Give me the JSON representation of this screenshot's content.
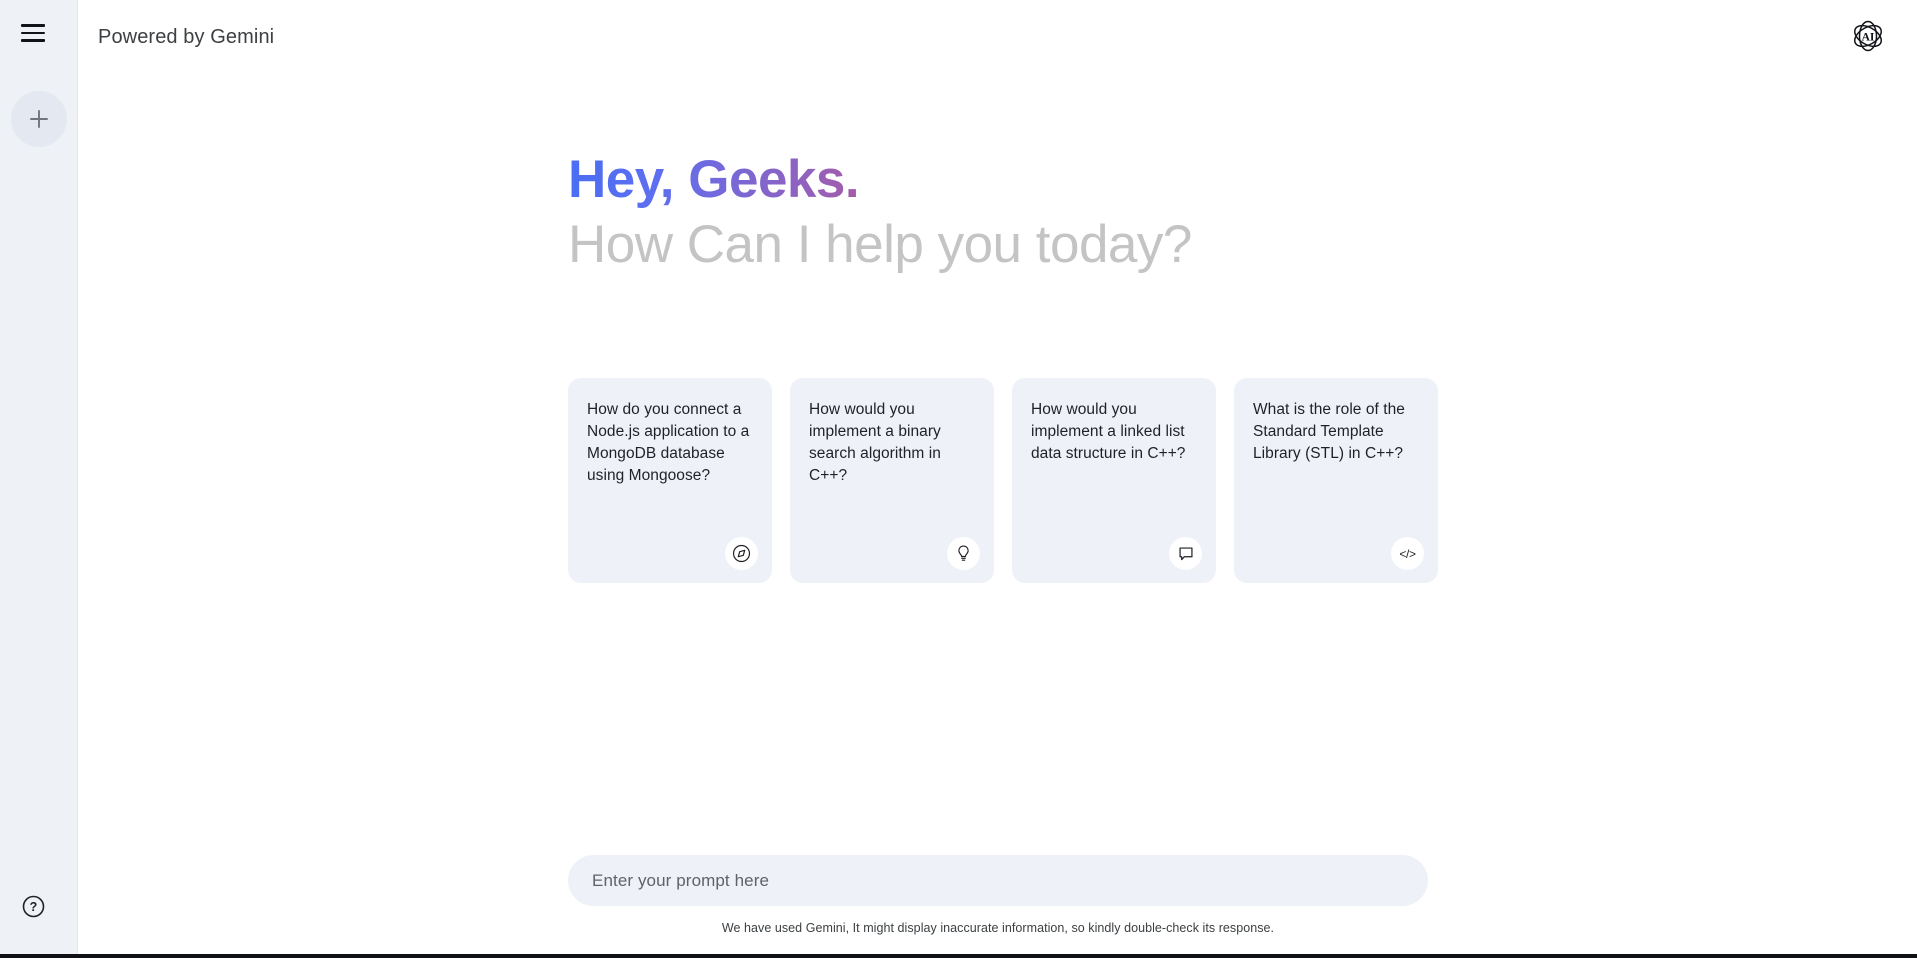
{
  "sidebar": {
    "menu_icon": "hamburger-menu-icon",
    "new_chat_icon": "plus-icon",
    "help_icon": "question-mark-help-icon",
    "background_color": "#eef1f6"
  },
  "header": {
    "brand_label": "Powered by Gemini",
    "logo_icon": "ai-atom-logo-icon",
    "logo_text": "AI"
  },
  "greeting": {
    "line1": "Hey, Geeks.",
    "line2": "How Can I help you today?",
    "gradient_start": "#4a6ef5",
    "gradient_mid": "#9a5fb5",
    "gradient_end": "#ee3b2f",
    "subtitle_color": "#c4c4c4"
  },
  "suggestion_cards": [
    {
      "text": "How do you connect a Node.js application to a MongoDB database using Mongoose?",
      "icon": "compass-icon"
    },
    {
      "text": "How would you implement a binary search algorithm in C++?",
      "icon": "lightbulb-icon"
    },
    {
      "text": "How would you implement a linked list data structure in C++?",
      "icon": "chat-bubble-icon"
    },
    {
      "text": "What is the role of the Standard Template Library (STL) in C++?",
      "icon": "code-icon",
      "icon_glyph": "</>"
    }
  ],
  "prompt": {
    "value": "",
    "placeholder": "Enter your prompt here",
    "background_color": "#eef1f7"
  },
  "footer": {
    "disclaimer": "We have used Gemini, It might display inaccurate information, so kindly double-check its response."
  }
}
